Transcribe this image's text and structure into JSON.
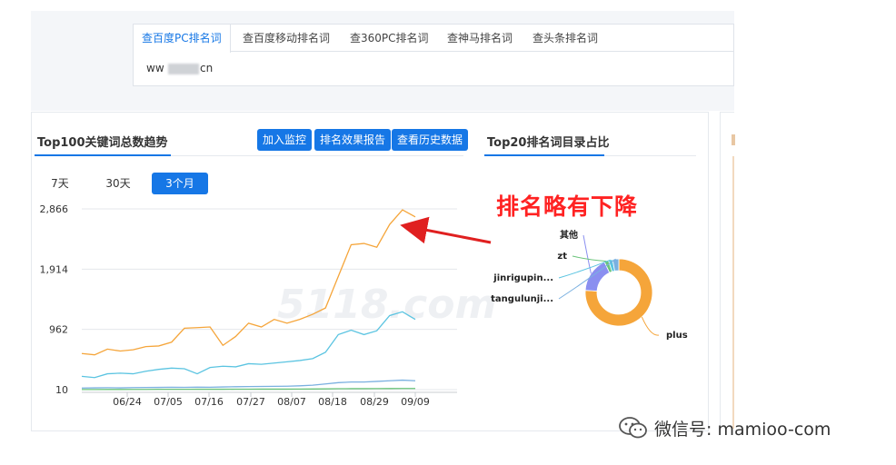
{
  "tabs": [
    {
      "label": "查百度PC排名词",
      "active": true
    },
    {
      "label": "查百度移动排名词",
      "active": false
    },
    {
      "label": "查360PC排名词",
      "active": false
    },
    {
      "label": "查神马排名词",
      "active": false
    },
    {
      "label": "查头条排名词",
      "active": false
    }
  ],
  "domain": {
    "prefix": "ww",
    "suffix": "cn"
  },
  "trend": {
    "title": "Top100关键词总数趋势",
    "buttons": [
      "加入监控",
      "排名效果报告",
      "查看历史数据"
    ],
    "ranges": [
      {
        "label": "7天",
        "active": false
      },
      {
        "label": "30天",
        "active": false
      },
      {
        "label": "3个月",
        "active": true
      }
    ]
  },
  "pie_section": {
    "title": "Top20排名词目录占比"
  },
  "annotation": "排名略有下降",
  "watermark": "5118.com",
  "footer": {
    "wechat": "微信号: mamioo-com"
  },
  "colors": {
    "accent": "#1677e6",
    "series_orange": "#f5a53a",
    "series_teal": "#5bc4e1",
    "series_blue": "#7ab0e0",
    "series_green": "#6ac47a",
    "annotation": "#ff2222"
  },
  "chart_data": [
    {
      "type": "line",
      "yticks": [
        "2,866",
        "1,914",
        "962",
        "10"
      ],
      "ylim": [
        10,
        2866
      ],
      "xticks": [
        "06/24",
        "07/05",
        "07/16",
        "07/27",
        "08/07",
        "08/18",
        "08/29",
        "09/09"
      ],
      "grid": true,
      "series": [
        {
          "values": [
            580,
            560,
            650,
            620,
            640,
            690,
            700,
            760,
            980,
            990,
            1000,
            710,
            850,
            1060,
            1000,
            1120,
            1060,
            1120,
            1200,
            1300,
            1800,
            2300,
            2320,
            2260,
            2620,
            2850,
            2740
          ]
        },
        {
          "values": [
            220,
            200,
            260,
            270,
            260,
            300,
            330,
            350,
            340,
            260,
            360,
            380,
            370,
            420,
            410,
            430,
            450,
            470,
            500,
            600,
            880,
            950,
            880,
            940,
            1180,
            1240,
            1120
          ]
        },
        {
          "values": [
            35,
            38,
            40,
            38,
            42,
            44,
            45,
            48,
            46,
            50,
            48,
            52,
            56,
            58,
            60,
            62,
            64,
            70,
            80,
            100,
            120,
            130,
            130,
            140,
            150,
            160,
            150
          ]
        },
        {
          "values": [
            12,
            12,
            13,
            13,
            14,
            14,
            15,
            15,
            15,
            16,
            16,
            16,
            17,
            17,
            18,
            18,
            18,
            19,
            20,
            22,
            24,
            25,
            25,
            26,
            27,
            28,
            28
          ]
        }
      ]
    },
    {
      "type": "pie",
      "labels": [
        "plus",
        "其他",
        "zt",
        "jinrigupin...",
        "tangulunji..."
      ],
      "values": [
        76,
        17,
        2,
        2,
        3
      ],
      "colors": [
        "#f5a53a",
        "#8a8ff0",
        "#6ac47a",
        "#5bc4e1",
        "#7ab0e0"
      ]
    }
  ]
}
